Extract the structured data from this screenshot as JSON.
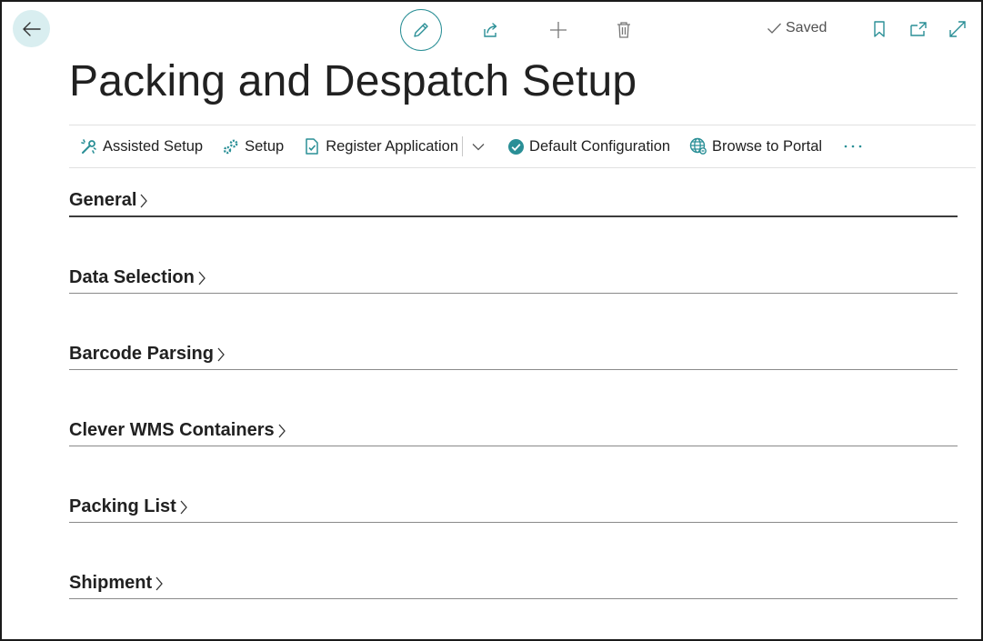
{
  "page": {
    "title": "Packing and Despatch Setup",
    "status": "Saved"
  },
  "toolbar": {
    "back_icon": "arrow-left-icon",
    "edit_icon": "pencil-icon",
    "share_icon": "share-icon",
    "new_icon": "plus-icon",
    "delete_icon": "trash-icon",
    "bookmark_icon": "bookmark-icon",
    "open_new_window_icon": "open-in-new-window-icon",
    "expand_icon": "expand-icon"
  },
  "actions": [
    {
      "label": "Assisted Setup",
      "icon": "assisted-setup-icon"
    },
    {
      "label": "Setup",
      "icon": "gears-icon"
    },
    {
      "label": "Register Application",
      "icon": "document-check-icon"
    },
    {
      "label": "Default Configuration",
      "icon": "check-circle-icon"
    },
    {
      "label": "Browse to Portal",
      "icon": "globe-icon"
    }
  ],
  "fasttabs": [
    {
      "label": "General"
    },
    {
      "label": "Data Selection"
    },
    {
      "label": "Barcode Parsing"
    },
    {
      "label": "Clever WMS Containers"
    },
    {
      "label": "Packing List"
    },
    {
      "label": "Shipment"
    }
  ],
  "colors": {
    "accent": "#2a8f96",
    "back_bg": "#d9eef0"
  }
}
